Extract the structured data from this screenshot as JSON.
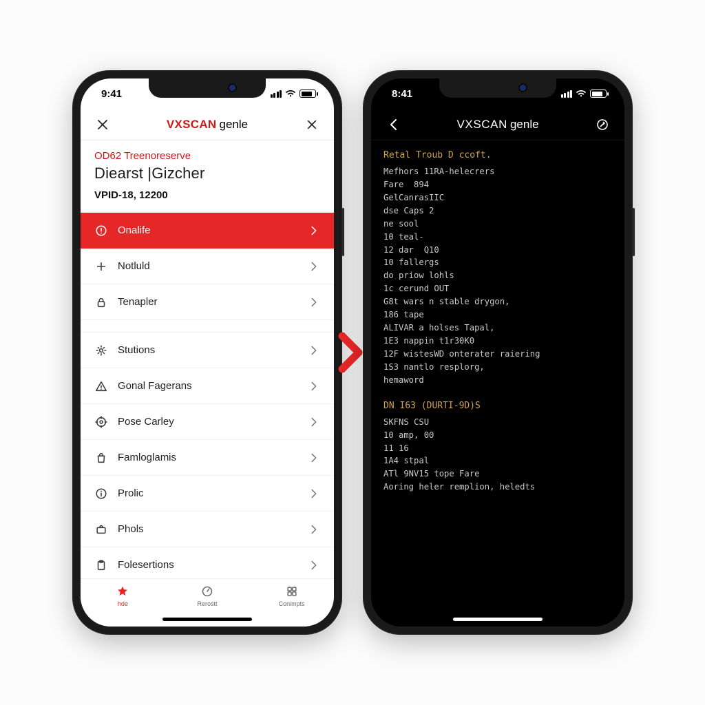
{
  "phone_left": {
    "status_time": "9:41",
    "nav": {
      "brand": "VXSCAN",
      "suffix": "genle"
    },
    "header": {
      "eyebrow": "OD62 Treenoreserve",
      "title": "Diearst |Gizcher",
      "subtitle": "VPID-18, 12200"
    },
    "rows_top": [
      {
        "icon": "alert-circle-icon",
        "label": "Onalife",
        "accent": true
      },
      {
        "icon": "plus-icon",
        "label": "Notluld",
        "accent": false
      },
      {
        "icon": "lock-icon",
        "label": "Tenapler",
        "accent": false
      }
    ],
    "rows_bottom": [
      {
        "icon": "gear-icon",
        "label": "Stutions"
      },
      {
        "icon": "warning-icon",
        "label": "Gonal Fagerans"
      },
      {
        "icon": "target-icon",
        "label": "Pose Carley"
      },
      {
        "icon": "bag-icon",
        "label": "Famloglamis"
      },
      {
        "icon": "info-icon",
        "label": "Prolic"
      },
      {
        "icon": "briefcase-icon",
        "label": "Phols"
      },
      {
        "icon": "clipboard-icon",
        "label": "Folesertions"
      }
    ],
    "tabs": [
      {
        "icon": "star-icon",
        "label": "hde",
        "active": true
      },
      {
        "icon": "gauge-icon",
        "label": "Rerostt",
        "active": false
      },
      {
        "icon": "grid-icon",
        "label": "Conimpts",
        "active": false
      }
    ]
  },
  "phone_right": {
    "status_time": "8:41",
    "nav": {
      "brand": "VXSCAN",
      "suffix": "genle"
    },
    "section1_title": "Retal Troub D ccoft.",
    "section1_lines": [
      "Mefhors 11RA-helecrers",
      "Fare  894",
      "GelCanrasIIC",
      "dse Caps 2",
      "ne sool",
      "10 teal-",
      "12 dar  Q10",
      "10 fallergs",
      "do priow lohls",
      "1c cerund OUT",
      "G8t wars n stable drygon,",
      "186 tape",
      "ALIVAR a holses Tapal,",
      "1E3 nappin t1r30K0",
      "12F wistesWD onterater raiering",
      "1S3 nantlo resplorg,",
      "hemaword"
    ],
    "section2_title": "DN I63 (DURTI-9D)S",
    "section2_lines": [
      "SKFNS CSU",
      "10 amp, 00",
      "11 16",
      "1A4 stpal",
      "ATl 9NV15 tope Fare",
      "Aoring heler remplion, heledts"
    ]
  }
}
